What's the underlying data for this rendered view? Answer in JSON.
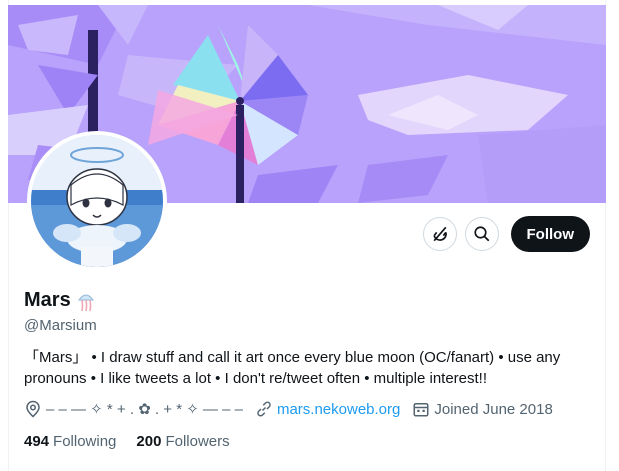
{
  "profile": {
    "name": "Mars",
    "handle": "@Marsium",
    "bio": "「Mars」 • I draw stuff and call it art once every blue moon (OC/fanart) • use any pronouns • I like tweets a lot • I don't re/tweet often • multiple interest!!",
    "location": "– – — ✧ * + . ✿ . + * ✧ — – –",
    "website": "mars.nekoweb.org",
    "joined": "Joined June 2018"
  },
  "stats": {
    "following_count": "494",
    "following_label": "Following",
    "followers_count": "200",
    "followers_label": "Followers"
  },
  "actions": {
    "follow_label": "Follow"
  },
  "icons": {
    "more": "notifications-off-icon",
    "search": "search-icon",
    "location": "location-pin-icon",
    "link": "link-icon",
    "calendar": "calendar-icon",
    "name_emoji": "jellyfish-emoji-icon"
  },
  "colors": {
    "banner_bg": "#b39dfa",
    "follow_bg": "#0f1419",
    "link": "#1d9bf0",
    "muted": "#536471"
  }
}
